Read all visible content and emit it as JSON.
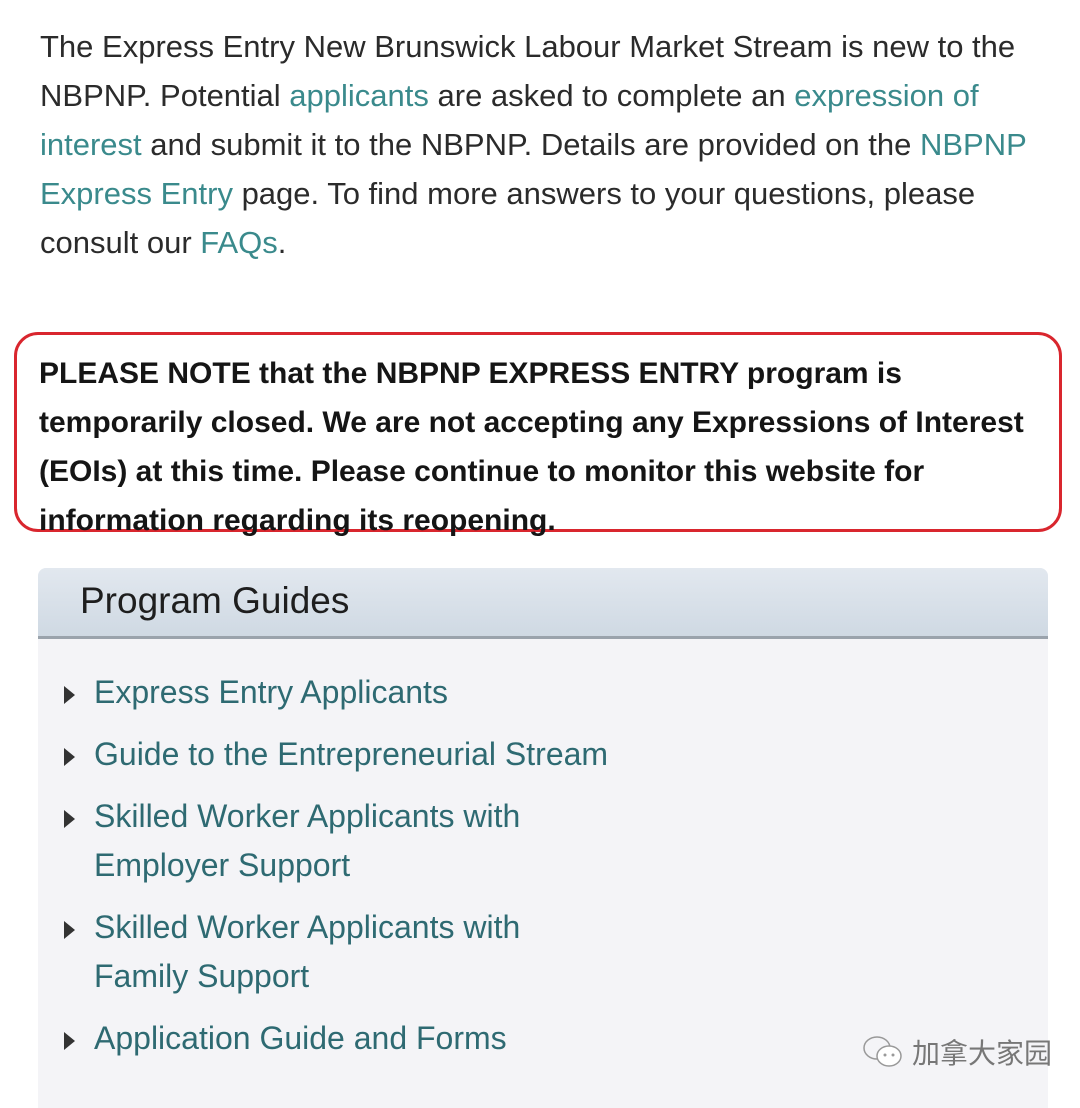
{
  "intro": {
    "t1": "The Express Entry New Brunswick Labour Market Stream is new to the NBPNP. Potential ",
    "link_applicants": "applicants",
    "t2": " are asked to complete an ",
    "link_eoi": "expression of interest",
    "t3": " and submit it to the NBPNP. Details are provided on the ",
    "link_ee_page": "NBPNP Express Entry",
    "t4": " page. To find more answers to your questions, please consult our ",
    "link_faqs": "FAQs",
    "t5": "."
  },
  "notice": "PLEASE NOTE that the NBPNP EXPRESS ENTRY program is temporarily closed. We are not accepting any Expressions of Interest (EOIs) at this time. Please continue to monitor this website for information regarding its reopening.",
  "program_guides": {
    "title": "Program Guides",
    "items": [
      "Express Entry Applicants",
      "Guide to the Entrepreneurial Stream",
      "Skilled Worker Applicants with Employer Support",
      "Skilled Worker Applicants with Family Support",
      "Application Guide and Forms"
    ]
  },
  "watermark": "加拿大家园",
  "colors": {
    "link": "#3a8a8c",
    "notice_border": "#d9262e"
  }
}
